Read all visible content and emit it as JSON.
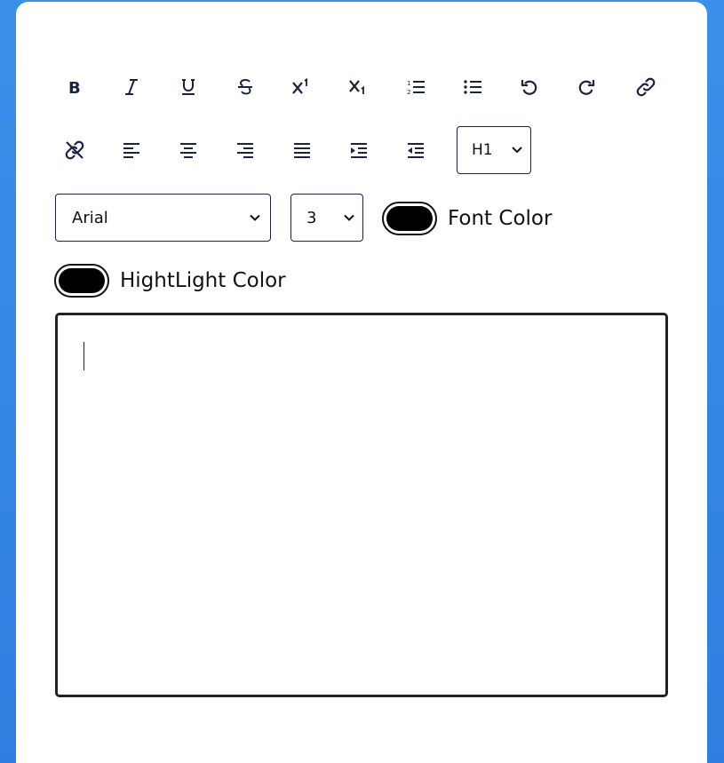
{
  "toolbar": {
    "row1": [
      {
        "name": "bold-button",
        "icon": "bold-icon",
        "glyph": "B"
      },
      {
        "name": "italic-button",
        "icon": "italic-icon"
      },
      {
        "name": "underline-button",
        "icon": "underline-icon"
      },
      {
        "name": "strikethrough-button",
        "icon": "strikethrough-icon"
      },
      {
        "name": "superscript-button",
        "icon": "superscript-icon"
      },
      {
        "name": "subscript-button",
        "icon": "subscript-icon"
      },
      {
        "name": "ordered-list-button",
        "icon": "ordered-list-icon"
      },
      {
        "name": "unordered-list-button",
        "icon": "unordered-list-icon"
      },
      {
        "name": "undo-button",
        "icon": "undo-icon"
      },
      {
        "name": "redo-button",
        "icon": "redo-icon"
      },
      {
        "name": "link-button",
        "icon": "link-icon"
      }
    ],
    "row2": [
      {
        "name": "unlink-button",
        "icon": "unlink-icon"
      },
      {
        "name": "align-left-button",
        "icon": "align-left-icon"
      },
      {
        "name": "align-center-button",
        "icon": "align-center-icon"
      },
      {
        "name": "align-right-button",
        "icon": "align-right-icon"
      },
      {
        "name": "justify-button",
        "icon": "justify-icon"
      },
      {
        "name": "indent-button",
        "icon": "indent-icon"
      },
      {
        "name": "outdent-button",
        "icon": "outdent-icon"
      }
    ],
    "heading_select": {
      "value": "H1"
    },
    "font_select": {
      "value": "Arial"
    },
    "size_select": {
      "value": "3"
    },
    "font_color": {
      "label": "Font Color",
      "color": "#000000"
    },
    "highlight_color": {
      "label": "HightLight Color",
      "color": "#000000"
    }
  },
  "editor": {
    "content": ""
  },
  "colors": {
    "background": "#3a8fe8",
    "icon": "#1a2345",
    "card": "#ffffff"
  }
}
